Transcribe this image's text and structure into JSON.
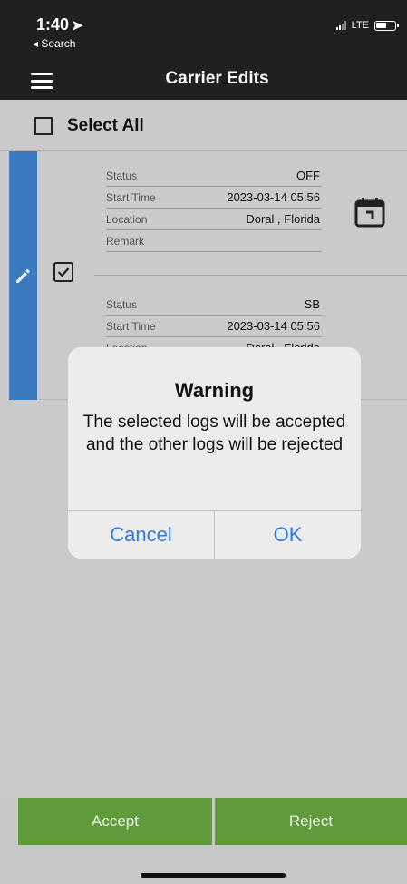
{
  "status_bar": {
    "time": "1:40",
    "location_glyph": "➤",
    "back_label": "◂ Search",
    "network": "LTE"
  },
  "nav": {
    "title": "Carrier Edits"
  },
  "select_all": {
    "label": "Select All"
  },
  "logs": [
    {
      "rows": [
        {
          "key": "Status",
          "value": "OFF"
        },
        {
          "key": "Start Time",
          "value": "2023-03-14  05:56"
        },
        {
          "key": "Location",
          "value": "Doral , Florida"
        },
        {
          "key": "Remark",
          "value": ""
        }
      ]
    },
    {
      "rows": [
        {
          "key": "Status",
          "value": "SB"
        },
        {
          "key": "Start Time",
          "value": "2023-03-14  05:56"
        },
        {
          "key": "Location",
          "value": "Doral , Florida"
        }
      ]
    }
  ],
  "dialog": {
    "title": "Warning",
    "message": "The selected logs will be accepted and the other logs will be rejected",
    "cancel_label": "Cancel",
    "ok_label": "OK"
  },
  "actions": {
    "accept_label": "Accept",
    "reject_label": "Reject"
  },
  "colors": {
    "accent_blue": "#3a7bbf",
    "button_green": "#609b3b",
    "dialog_link": "#2d7ae0"
  }
}
